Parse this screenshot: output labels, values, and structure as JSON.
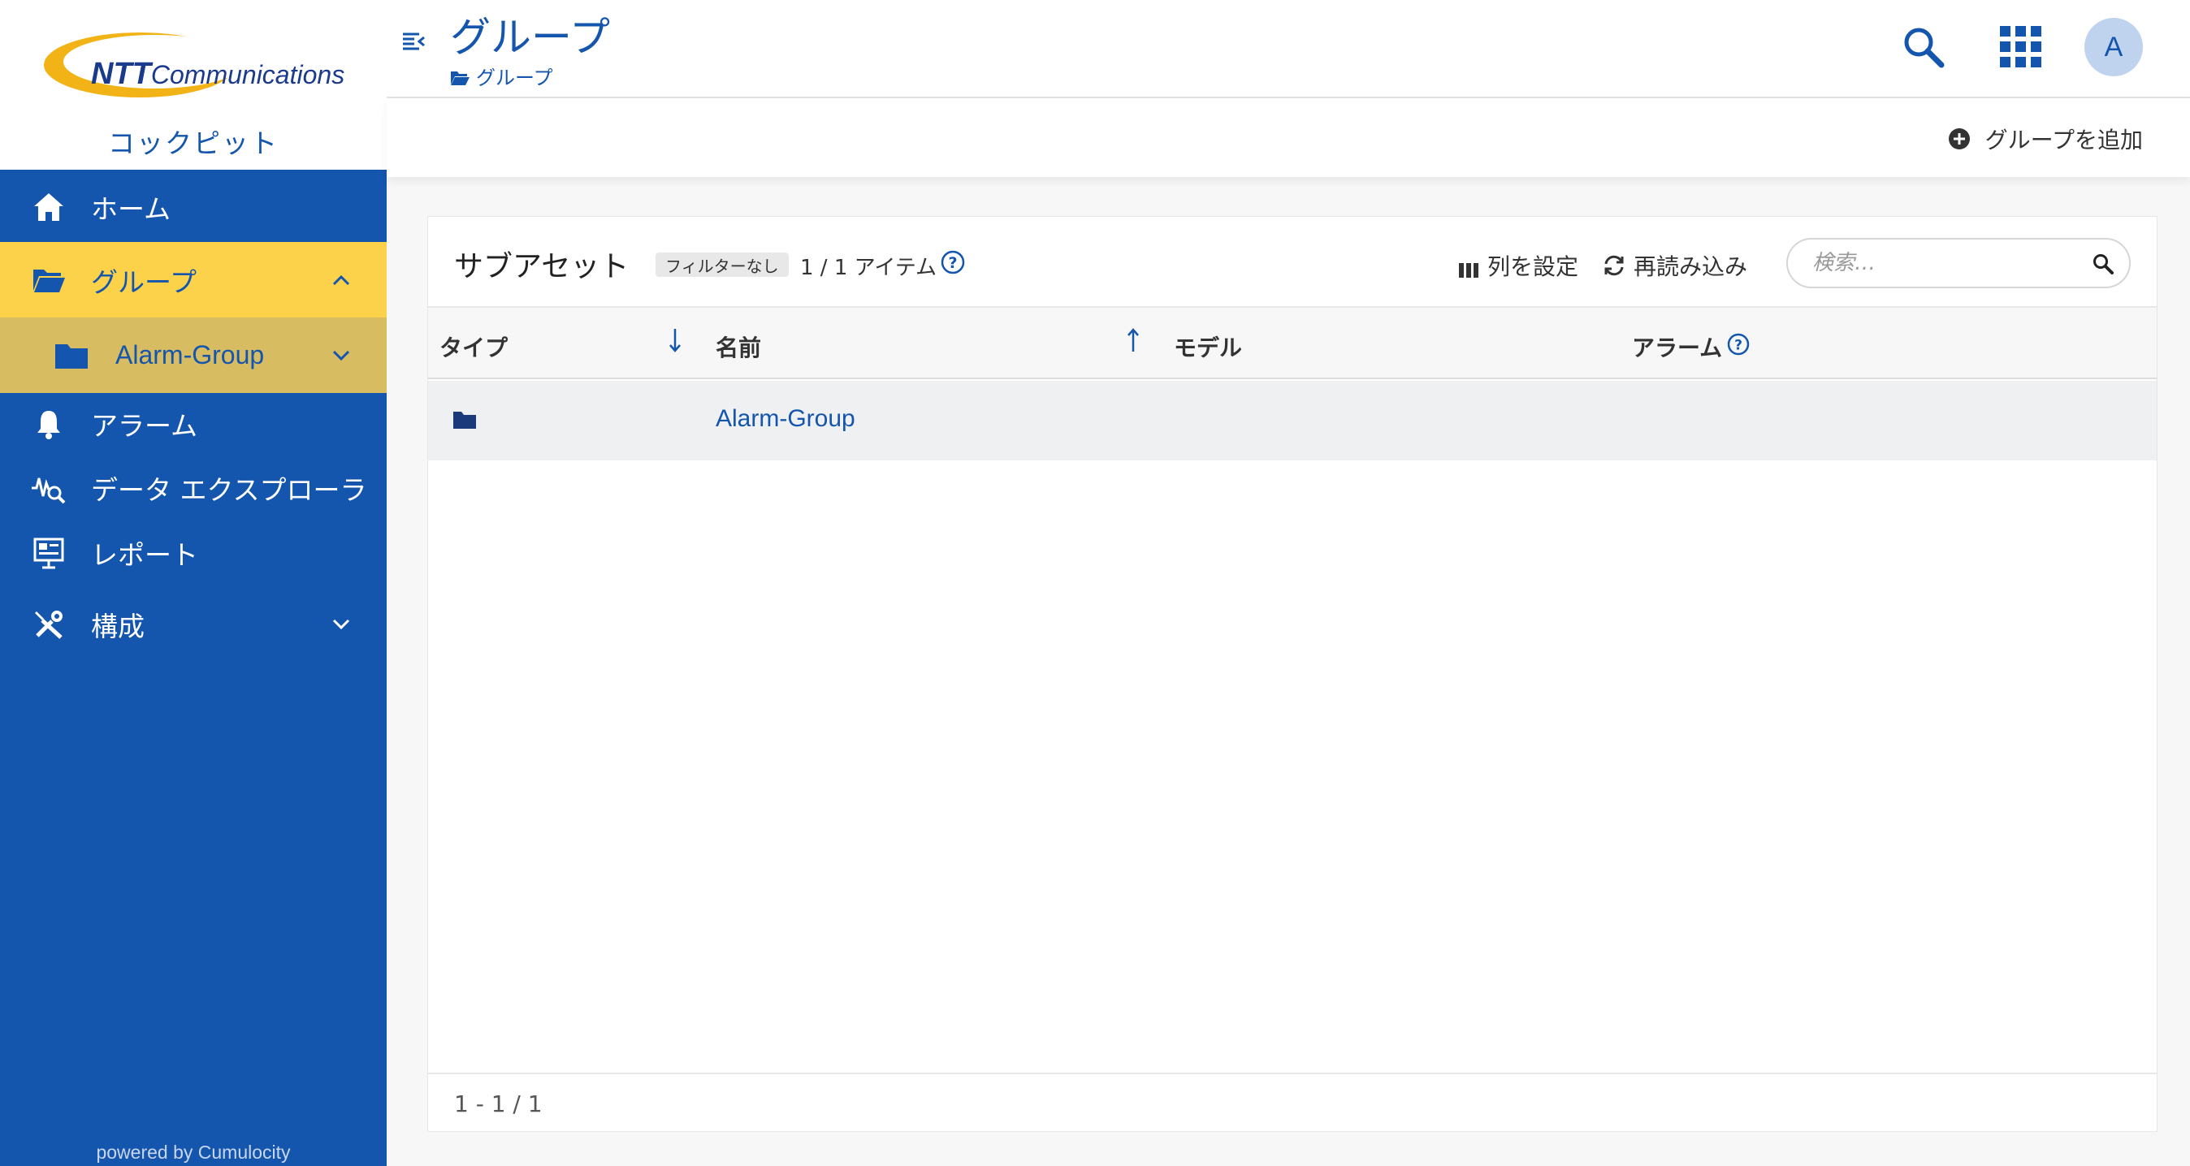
{
  "brand": {
    "logo_bold": "NTT",
    "logo_rest": "Communications",
    "app_name": "コックピット",
    "powered_by": "powered by Cumulocity"
  },
  "nav": {
    "home": "ホーム",
    "groups": "グループ",
    "group_child": "Alarm-Group",
    "alarms": "アラーム",
    "data_explorer": "データ エクスプローラ",
    "reports": "レポート",
    "config": "構成"
  },
  "header": {
    "title": "グループ",
    "breadcrumb": "グループ",
    "avatar_initial": "A"
  },
  "actions": {
    "add_group": "グループを追加"
  },
  "subassets": {
    "title": "サブアセット",
    "filter_badge": "フィルターなし",
    "count": "1 / 1 アイテム",
    "configure_columns": "列を設定",
    "reload": "再読み込み",
    "search_placeholder": "検索…",
    "columns": [
      "タイプ",
      "名前",
      "モデル",
      "アラーム"
    ],
    "rows": [
      {
        "type_icon": "folder-icon",
        "name": "Alarm-Group",
        "model": "",
        "alarms": ""
      }
    ],
    "pagination": "1 - 1 / 1"
  },
  "colors": {
    "primary": "#1455ad",
    "active_nav": "#fdd24b",
    "sub_nav": "#d7bc62",
    "page_bg": "#f7f7f7"
  }
}
